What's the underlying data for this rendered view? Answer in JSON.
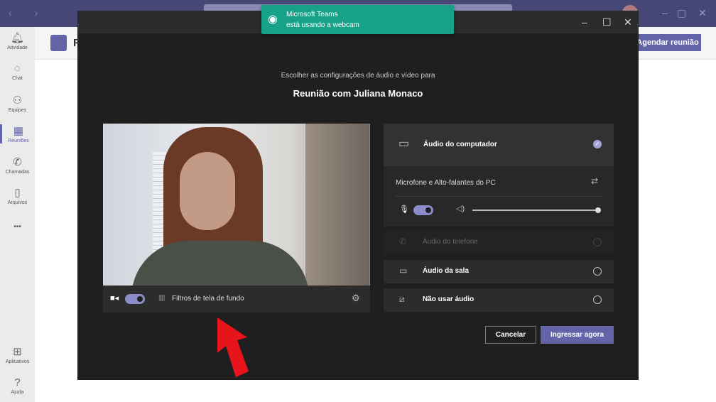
{
  "app": {
    "search_placeholder": "",
    "page_title": "R",
    "schedule_button": "Agendar reunião",
    "win_min": "–",
    "win_max": "▢",
    "win_close": "✕"
  },
  "sidebar": {
    "items": [
      {
        "label": "Atividade",
        "icon": "bell-icon"
      },
      {
        "label": "Chat",
        "icon": "chat-icon"
      },
      {
        "label": "Equipes",
        "icon": "teams-icon"
      },
      {
        "label": "Reuniões",
        "icon": "calendar-icon"
      },
      {
        "label": "Chamadas",
        "icon": "phone-icon"
      },
      {
        "label": "Arquivos",
        "icon": "file-icon"
      }
    ],
    "more": "•••",
    "apps": "Aplicativos",
    "help": "Ajuda"
  },
  "toast": {
    "title": "Microsoft Teams",
    "message": "está usando a webcam"
  },
  "modal": {
    "subtitle": "Escolher as configurações de áudio e vídeo para",
    "title": "Reunião com Juliana Monaco",
    "min": "–",
    "max": "☐",
    "close": "✕"
  },
  "video": {
    "camera_on": true,
    "filters_label": "Filtros de tela de fundo"
  },
  "audio": {
    "computer": "Áudio do computador",
    "device": "Microfone e Alto-falantes do PC",
    "mic_on": true,
    "volume": 1.0,
    "phone": "Áudio do telefone",
    "room": "Áudio da sala",
    "none": "Não usar áudio",
    "selected": "computer"
  },
  "actions": {
    "cancel": "Cancelar",
    "join": "Ingressar agora"
  },
  "colors": {
    "accent": "#6264a7",
    "toast": "#17a288",
    "arrow": "#e8141c"
  }
}
